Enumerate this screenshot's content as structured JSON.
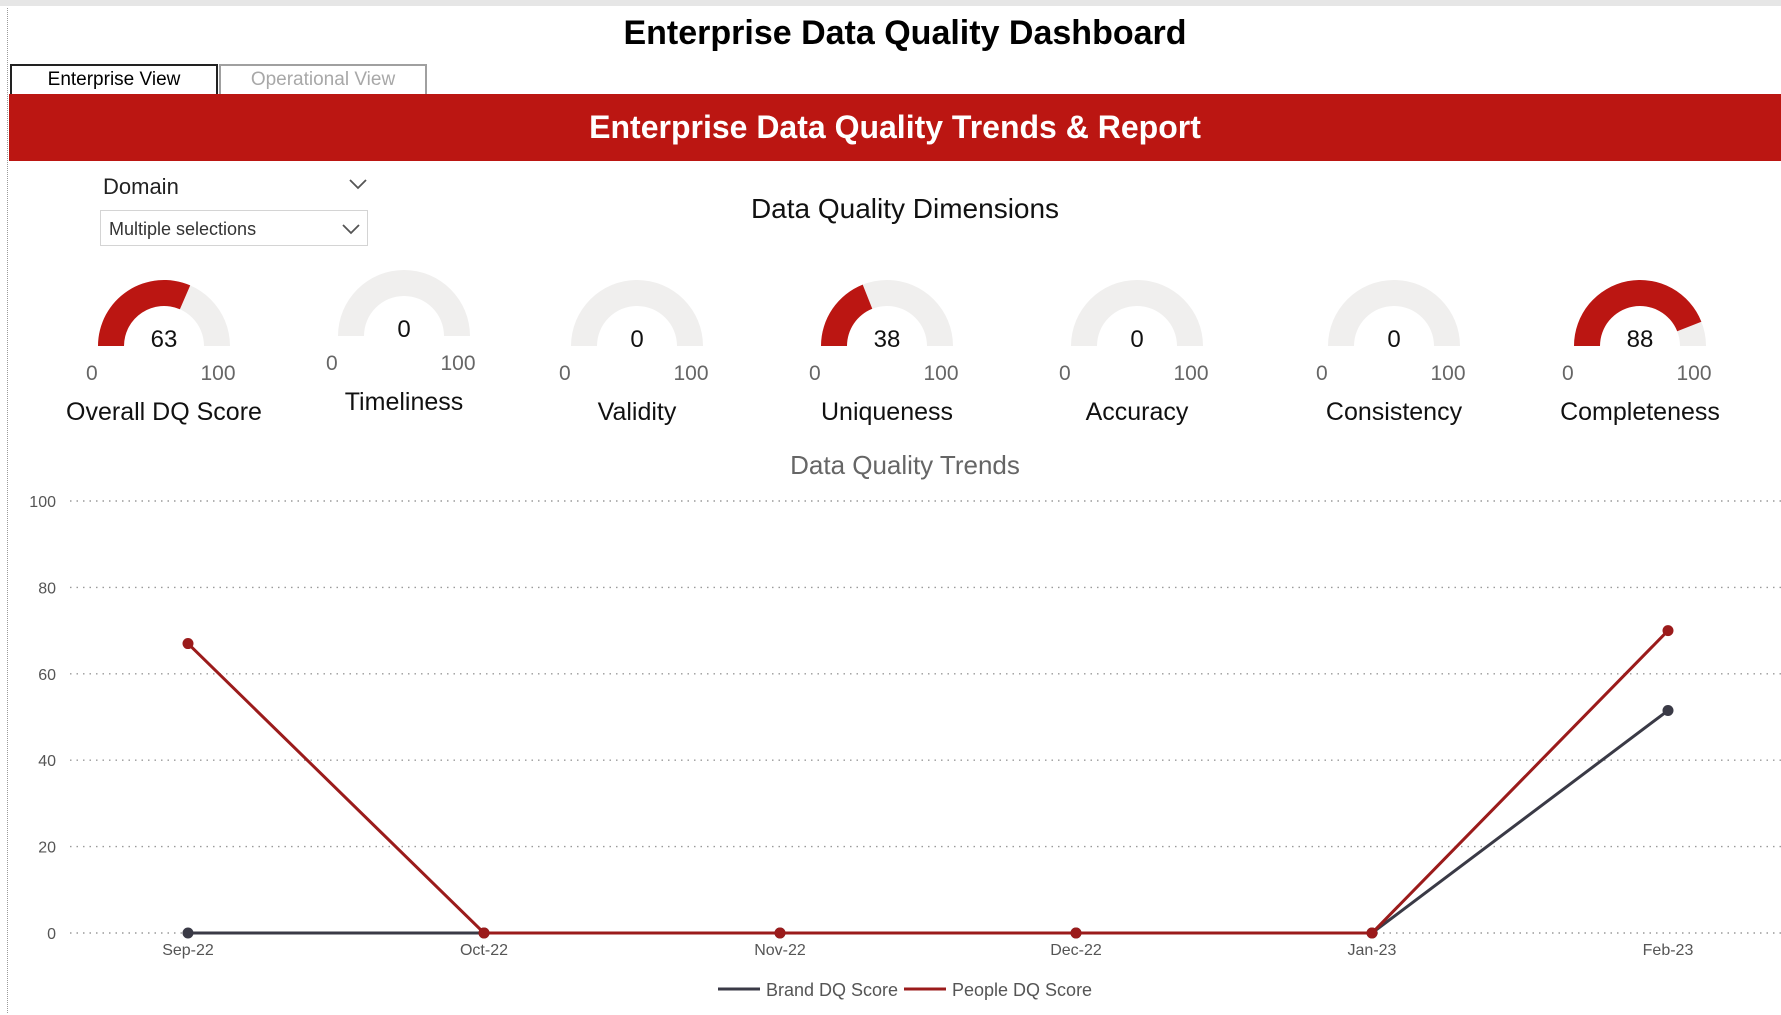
{
  "page": {
    "title": "Enterprise Data Quality Dashboard"
  },
  "tabs": [
    {
      "label": "Enterprise View",
      "active": true
    },
    {
      "label": "Operational View",
      "active": false
    }
  ],
  "banner": {
    "title": "Enterprise Data Quality Trends & Report"
  },
  "slicer": {
    "title": "Domain",
    "value": "Multiple selections",
    "icon": "chevron-down-icon"
  },
  "dimensions": {
    "title": "Data Quality Dimensions",
    "accent_color": "#bb1612",
    "track_color": "#f0efee",
    "gauges": [
      {
        "label": "Overall DQ Score",
        "value": 63,
        "value_text": "63",
        "min": "0",
        "max": "100"
      },
      {
        "label": "Timeliness",
        "value": 0,
        "value_text": "0",
        "min": "0",
        "max": "100"
      },
      {
        "label": "Validity",
        "value": 0,
        "value_text": "0",
        "min": "0",
        "max": "100"
      },
      {
        "label": "Uniqueness",
        "value": 38,
        "value_text": "38",
        "min": "0",
        "max": "100"
      },
      {
        "label": "Accuracy",
        "value": 0,
        "value_text": "0",
        "min": "0",
        "max": "100"
      },
      {
        "label": "Consistency",
        "value": 0,
        "value_text": "0",
        "min": "0",
        "max": "100"
      },
      {
        "label": "Completeness",
        "value": 88,
        "value_text": "88",
        "min": "0",
        "max": "100"
      }
    ]
  },
  "chart_data": {
    "type": "line",
    "title": "Data Quality Trends",
    "xlabel": "",
    "ylabel": "",
    "categories": [
      "Sep-22",
      "Oct-22",
      "Nov-22",
      "Dec-22",
      "Jan-23",
      "Feb-23"
    ],
    "ylim": [
      0,
      100
    ],
    "yticks": [
      "0",
      "20",
      "40",
      "60",
      "80",
      "100"
    ],
    "grid": true,
    "legend_position": "bottom-center",
    "series": [
      {
        "name": "Brand DQ Score",
        "color": "#3a3a46",
        "values": [
          0,
          0,
          0,
          0,
          0,
          51.5
        ]
      },
      {
        "name": "People DQ Score",
        "color": "#9b1b1b",
        "values": [
          67,
          0,
          0,
          0,
          0,
          70
        ]
      }
    ]
  }
}
